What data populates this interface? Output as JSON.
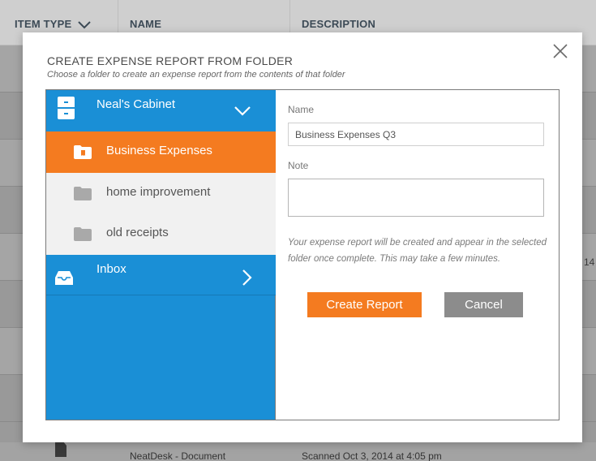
{
  "background_table": {
    "columns": [
      "ITEM TYPE",
      "NAME",
      "DESCRIPTION"
    ],
    "row_fragments": [
      "14"
    ],
    "bottom_row": {
      "name": "NeatDesk - Document",
      "description": "Scanned Oct 3, 2014 at 4:05 pm"
    }
  },
  "modal": {
    "title": "CREATE EXPENSE REPORT FROM FOLDER",
    "subtitle": "Choose a folder to create an expense report from the contents of that folder",
    "close_icon": "close-icon"
  },
  "folders": {
    "cabinet": {
      "label": "Neal's Cabinet",
      "icon": "cabinet-icon",
      "expanded": true
    },
    "items": [
      {
        "label": "Business Expenses",
        "icon": "receipt-folder-icon",
        "selected": true
      },
      {
        "label": "home improvement",
        "icon": "folder-icon",
        "selected": false
      },
      {
        "label": "old receipts",
        "icon": "folder-icon",
        "selected": false
      }
    ],
    "inbox": {
      "label": "Inbox",
      "icon": "inbox-icon"
    }
  },
  "form": {
    "name_label": "Name",
    "name_value": "Business Expenses Q3",
    "note_label": "Note",
    "note_value": "",
    "info": "Your expense report will be created and appear in the selected folder once complete. This may take a few minutes.",
    "create_label": "Create Report",
    "cancel_label": "Cancel"
  },
  "colors": {
    "accent_blue": "#1a8fd6",
    "accent_orange": "#f47b20",
    "cancel_gray": "#8c8c8c",
    "overlay_gray": "#9a9a9a"
  }
}
